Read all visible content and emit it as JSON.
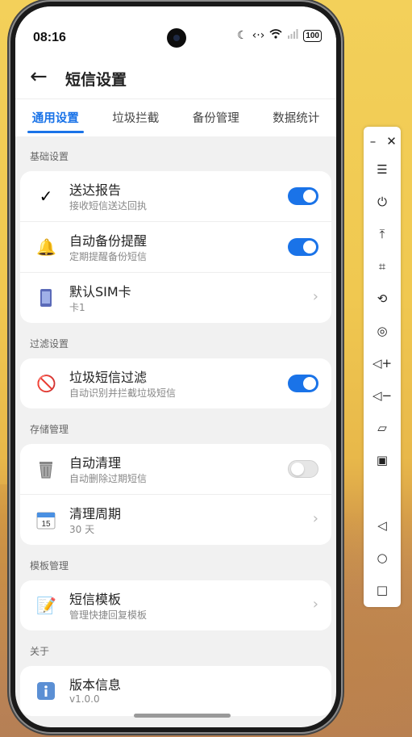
{
  "status": {
    "time": "08:16",
    "battery": "100"
  },
  "header": {
    "back_icon": "←",
    "title": "短信设置"
  },
  "tabs": [
    "通用设置",
    "垃圾拦截",
    "备份管理",
    "数据统计"
  ],
  "sections": {
    "basic": "基础设置",
    "filter": "过滤设置",
    "storage": "存储管理",
    "template": "模板管理",
    "about": "关于"
  },
  "items": {
    "delivery": {
      "label": "送达报告",
      "sub": "接收短信送达回执",
      "on": true
    },
    "backup_remind": {
      "label": "自动备份提醒",
      "sub": "定期提醒备份短信",
      "on": true
    },
    "sim": {
      "label": "默认SIM卡",
      "sub": "卡1"
    },
    "spam": {
      "label": "垃圾短信过滤",
      "sub": "自动识别并拦截垃圾短信",
      "on": true
    },
    "auto_clean": {
      "label": "自动清理",
      "sub": "自动删除过期短信",
      "on": false
    },
    "clean_period": {
      "label": "清理周期",
      "sub": "30 天"
    },
    "sms_template": {
      "label": "短信模板",
      "sub": "管理快捷回复模板"
    },
    "version": {
      "label": "版本信息",
      "sub": "v1.0.0"
    }
  },
  "colors": {
    "accent": "#1a73e8"
  }
}
